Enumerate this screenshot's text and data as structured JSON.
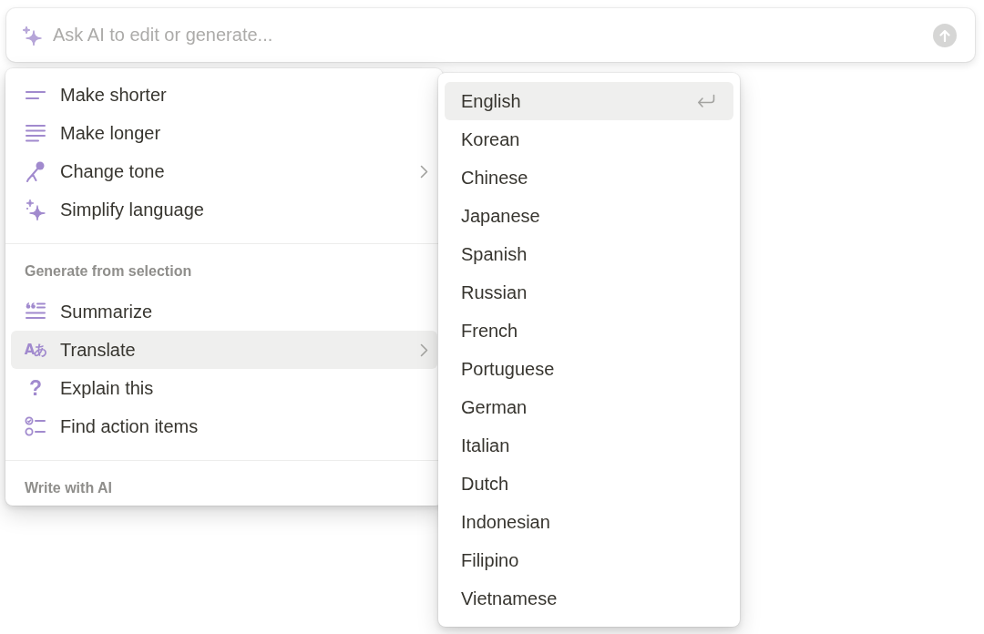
{
  "prompt_bar": {
    "placeholder": "Ask AI to edit or generate..."
  },
  "menu": {
    "sections": [
      {
        "items": [
          {
            "label": "Make shorter",
            "submenu": false,
            "selected": false
          },
          {
            "label": "Make longer",
            "submenu": false,
            "selected": false
          },
          {
            "label": "Change tone",
            "submenu": true,
            "selected": false
          },
          {
            "label": "Simplify language",
            "submenu": false,
            "selected": false
          }
        ]
      },
      {
        "heading": "Generate from selection",
        "items": [
          {
            "label": "Summarize",
            "submenu": false,
            "selected": false
          },
          {
            "label": "Translate",
            "glyph": "Aあ",
            "submenu": true,
            "selected": true
          },
          {
            "label": "Explain this",
            "glyph": "?",
            "submenu": false,
            "selected": false
          },
          {
            "label": "Find action items",
            "submenu": false,
            "selected": false
          }
        ]
      },
      {
        "heading": "Write with AI"
      }
    ]
  },
  "language_menu": {
    "items": [
      {
        "label": "English",
        "selected": true
      },
      {
        "label": "Korean",
        "selected": false
      },
      {
        "label": "Chinese",
        "selected": false
      },
      {
        "label": "Japanese",
        "selected": false
      },
      {
        "label": "Spanish",
        "selected": false
      },
      {
        "label": "Russian",
        "selected": false
      },
      {
        "label": "French",
        "selected": false
      },
      {
        "label": "Portuguese",
        "selected": false
      },
      {
        "label": "German",
        "selected": false
      },
      {
        "label": "Italian",
        "selected": false
      },
      {
        "label": "Dutch",
        "selected": false
      },
      {
        "label": "Indonesian",
        "selected": false
      },
      {
        "label": "Filipino",
        "selected": false
      },
      {
        "label": "Vietnamese",
        "selected": false
      }
    ]
  }
}
